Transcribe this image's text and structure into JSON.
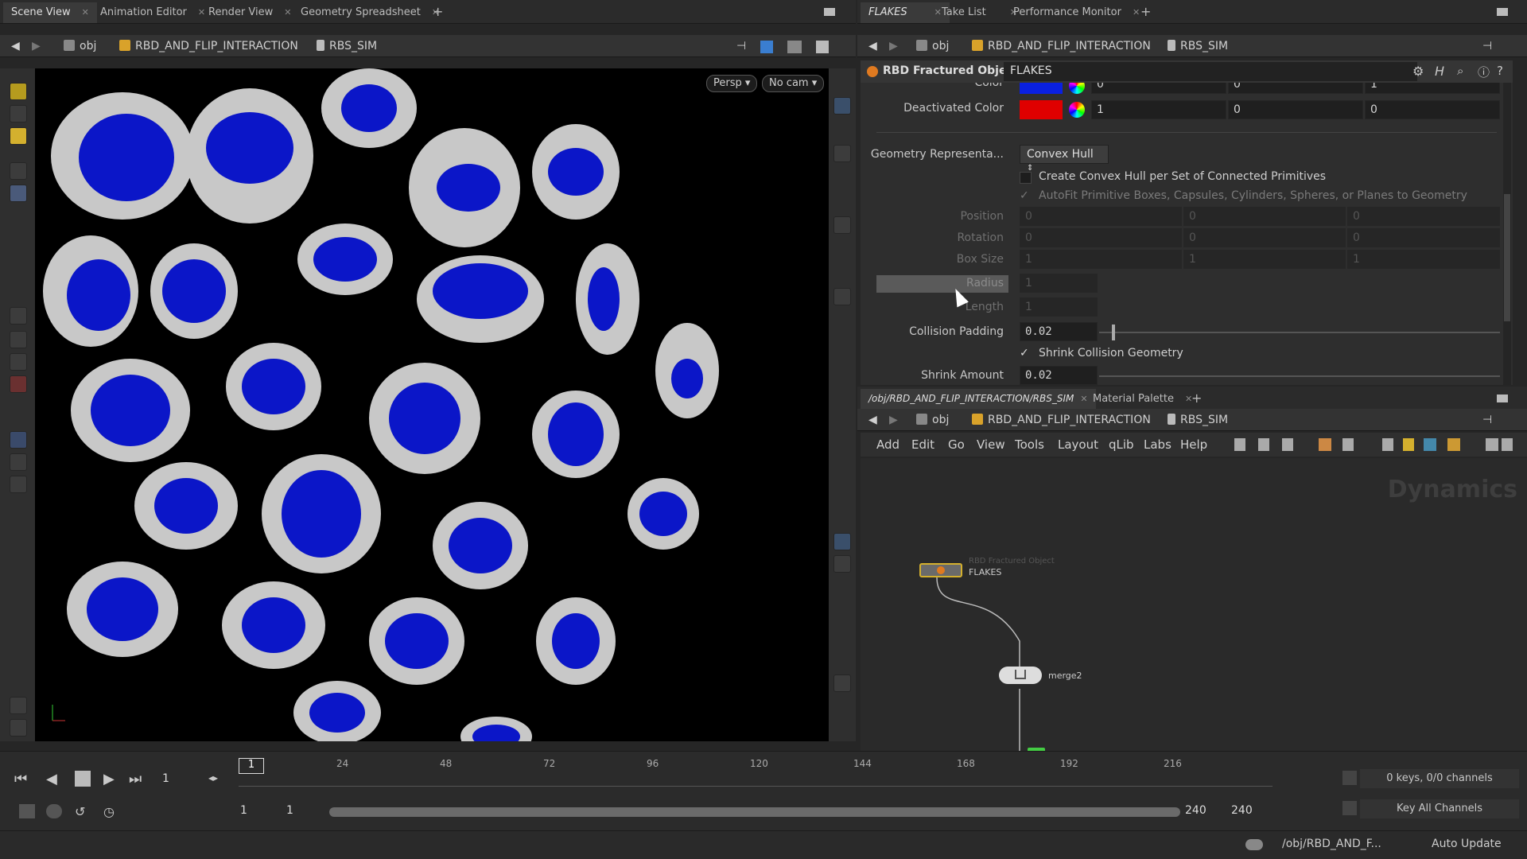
{
  "left_tabs": [
    {
      "label": "Scene View"
    },
    {
      "label": "Animation Editor"
    },
    {
      "label": "Render View"
    },
    {
      "label": "Geometry Spreadsheet"
    }
  ],
  "right_tabs": [
    {
      "label": "FLAKES"
    },
    {
      "label": "Take List"
    },
    {
      "label": "Performance Monitor"
    }
  ],
  "net_tabs": [
    {
      "label": "/obj/RBD_AND_FLIP_INTERACTION/RBS_SIM"
    },
    {
      "label": "Material Palette"
    }
  ],
  "path": {
    "obj": "obj",
    "node1": "RBD_AND_FLIP_INTERACTION",
    "node2": "RBS_SIM"
  },
  "viewport": {
    "persp": "Persp",
    "cam": "No cam"
  },
  "params": {
    "node_type": "RBD Fractured Object",
    "node_name": "FLAKES",
    "color_label": "Color",
    "color_vals": [
      "0",
      "0",
      "1"
    ],
    "deactivated_label": "Deactivated Color",
    "deactivated_vals": [
      "1",
      "0",
      "0"
    ],
    "geo_rep_label": "Geometry Representa...",
    "geo_rep_value": "Convex Hull",
    "convex_check": "Create Convex Hull per Set of Connected Primitives",
    "autofit_check": "AutoFit Primitive Boxes, Capsules, Cylinders, Spheres, or Planes to Geometry",
    "position_label": "Position",
    "position_vals": [
      "0",
      "0",
      "0"
    ],
    "rotation_label": "Rotation",
    "rotation_vals": [
      "0",
      "0",
      "0"
    ],
    "boxsize_label": "Box Size",
    "boxsize_vals": [
      "1",
      "1",
      "1"
    ],
    "radius_label": "Radius",
    "radius_val": "1",
    "length_label": "Length",
    "length_val": "1",
    "collision_label": "Collision Padding",
    "collision_val": "0.02",
    "shrink_check": "Shrink Collision Geometry",
    "shrink_label": "Shrink Amount",
    "shrink_val": "0.02"
  },
  "menus": [
    "Add",
    "Edit",
    "Go",
    "View",
    "Tools",
    "Layout",
    "qLib",
    "Labs",
    "Help"
  ],
  "network": {
    "context": "Dynamics",
    "node1_type": "RBD Fractured Object",
    "node1_name": "FLAKES",
    "node2_name": "merge2"
  },
  "timeline": {
    "frame": "1",
    "ticks": [
      "24",
      "48",
      "72",
      "96",
      "120",
      "144",
      "168",
      "192",
      "216"
    ],
    "range_start": "1",
    "range_start2": "1",
    "range_end": "240",
    "range_end2": "240",
    "keys": "0 keys, 0/0 channels",
    "key_all": "Key All Channels"
  },
  "status": {
    "path": "/obj/RBD_AND_F...",
    "update": "Auto Update"
  },
  "colors": {
    "accent_yellow": "#d4b02e",
    "flake_blue": "#0a14c8",
    "flake_grey": "#c9c9c9",
    "red": "#e00000",
    "blue": "#0a20e0"
  }
}
